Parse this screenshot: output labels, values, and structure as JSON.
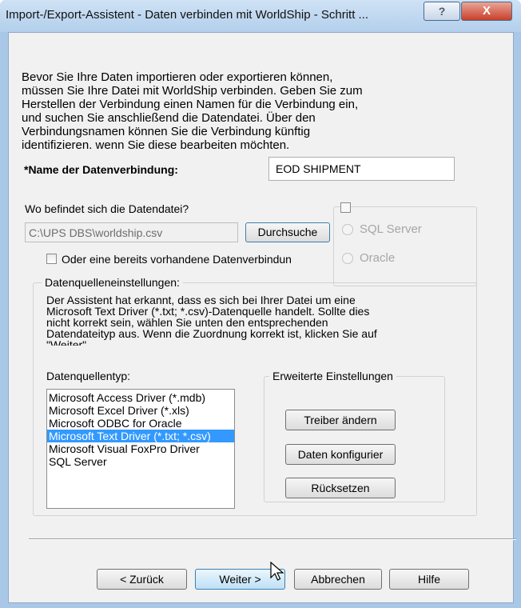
{
  "window": {
    "title": "Import-/Export-Assistent - Daten verbinden mit WorldShip - Schritt ...",
    "help_glyph": "?",
    "close_glyph": "X"
  },
  "intro": {
    "lines": [
      "Bevor Sie Ihre Daten importieren oder exportieren können,",
      "müssen Sie Ihre Datei mit WorldShip verbinden. Geben Sie zum",
      "Herstellen der Verbindung einen Namen für die Verbindung ein,",
      "und suchen Sie anschließend die Datendatei. Über den",
      "Verbindungsnamen können Sie die Verbindung künftig",
      "identifizieren. wenn Sie diese bearbeiten möchten."
    ]
  },
  "connection_name": {
    "label": "*Name der Datenverbindung:",
    "value": "EOD SHIPMENT"
  },
  "file_location": {
    "label": "Wo befindet sich die Datendatei?",
    "path": "C:\\UPS DBS\\worldship.csv",
    "browse_label": "Durchsuche"
  },
  "existing_connection": {
    "label": "Oder eine bereits vorhandene Datenverbindun",
    "checked": false
  },
  "db_options": {
    "sql_server": "SQL Server",
    "oracle": "Oracle"
  },
  "datasource_settings": {
    "legend": "Datenquelleneinstellungen:",
    "description": [
      "Der Assistent hat erkannt, dass es sich bei Ihrer Datei um eine",
      "Microsoft Text Driver (*.txt; *.csv)-Datenquelle handelt. Sollte dies",
      "nicht korrekt sein, wählen Sie unten den entsprechenden",
      "Datendateityp aus. Wenn die Zuordnung korrekt ist, klicken Sie auf",
      "\"Weiter\"."
    ],
    "type_label": "Datenquellentyp:",
    "types": [
      "Microsoft Access Driver (*.mdb)",
      "Microsoft Excel Driver (*.xls)",
      "Microsoft ODBC for Oracle",
      "Microsoft Text Driver (*.txt; *.csv)",
      "Microsoft Visual FoxPro Driver",
      "SQL Server"
    ],
    "selected_type": "Microsoft Text Driver (*.txt; *.csv)"
  },
  "advanced": {
    "legend": "Erweiterte Einstellungen",
    "change_driver": "Treiber ändern",
    "configure_data": "Daten konfigurier",
    "reset": "Rücksetzen"
  },
  "footer": {
    "back": "< Zurück",
    "next": "Weiter >",
    "cancel": "Abbrechen",
    "help": "Hilfe"
  },
  "colors": {
    "selection": "#3399ff",
    "titlebar": "#b9d3ee"
  }
}
